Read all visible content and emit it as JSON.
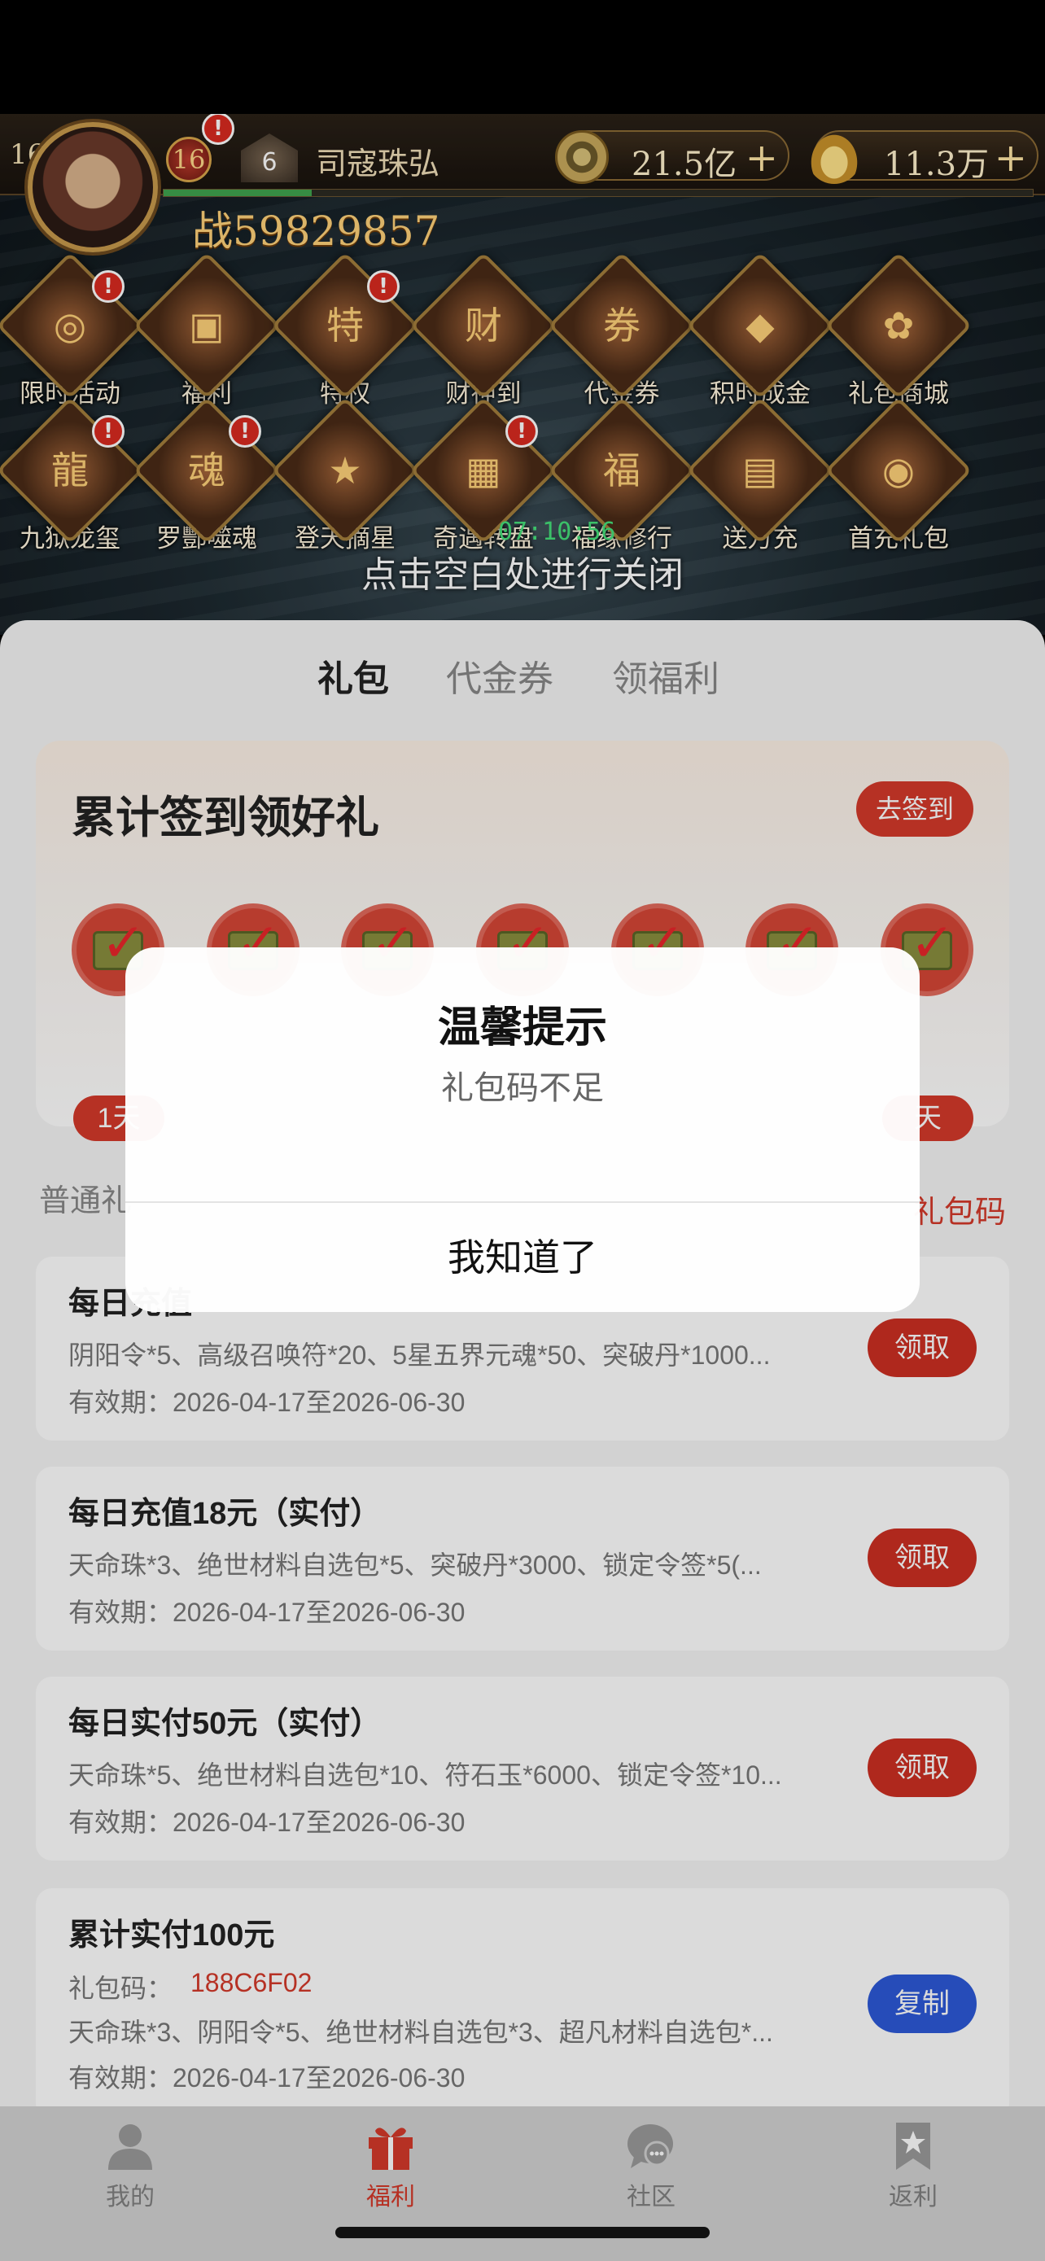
{
  "game": {
    "player_level": "166",
    "vip_level": "16",
    "rank_level": "6",
    "player_name": "司寇珠弘",
    "power": "战59829857",
    "exp_progress": 0.17,
    "currencies": [
      {
        "icon": "copper-coin-icon",
        "value": "21.5亿",
        "plus": "+"
      },
      {
        "icon": "gold-ingot-icon",
        "value": "11.3万",
        "plus": "+"
      }
    ],
    "red_dot": "!",
    "icons_row1": [
      {
        "label": "限时活动",
        "glyph": "◎",
        "badge": true
      },
      {
        "label": "福利",
        "glyph": "▣",
        "badge": false
      },
      {
        "label": "特权",
        "glyph": "特",
        "badge": true
      },
      {
        "label": "财神到",
        "glyph": "财",
        "badge": false
      },
      {
        "label": "代金券",
        "glyph": "券",
        "badge": false
      },
      {
        "label": "积时成金",
        "glyph": "◆",
        "badge": false
      },
      {
        "label": "礼包商城",
        "glyph": "✿",
        "badge": false
      }
    ],
    "icons_row2": [
      {
        "label": "九狱龙玺",
        "glyph": "龍",
        "badge": true
      },
      {
        "label": "罗酆噬魂",
        "glyph": "魂",
        "badge": true
      },
      {
        "label": "登天摘星",
        "glyph": "★",
        "badge": false
      },
      {
        "label": "奇遇转盘",
        "glyph": "▦",
        "badge": true
      },
      {
        "label": "福缘修行",
        "glyph": "福",
        "badge": false
      },
      {
        "label": "送万充",
        "glyph": "▤",
        "badge": false
      },
      {
        "label": "首充礼包",
        "glyph": "◉",
        "badge": false
      }
    ],
    "timer": "07:10:56",
    "close_hint": "点击空白处进行关闭"
  },
  "tabs": [
    {
      "label": "礼包",
      "active": true
    },
    {
      "label": "代金券",
      "active": false
    },
    {
      "label": "领福利",
      "active": false
    }
  ],
  "signin": {
    "title": "累计签到领好礼",
    "button": "去签到",
    "days_total": 7,
    "days_checked": 7,
    "first_day_pill": "1天",
    "last_day_pill": "天"
  },
  "section": {
    "label": "普通礼",
    "link": "礼包码"
  },
  "gifts": [
    {
      "title": "每日充值",
      "desc": "阴阳令*5、高级召唤符*20、5星五界元魂*50、突破丹*1000...",
      "date": "有效期：2026-04-17至2026-06-30",
      "button": "领取"
    },
    {
      "title": "每日充值18元（实付）",
      "desc": "天命珠*3、绝世材料自选包*5、突破丹*3000、锁定令签*5(...",
      "date": "有效期：2026-04-17至2026-06-30",
      "button": "领取"
    },
    {
      "title": "每日实付50元（实付）",
      "desc": "天命珠*5、绝世材料自选包*10、符石玉*6000、锁定令签*10...",
      "date": "有效期：2026-04-17至2026-06-30",
      "button": "领取"
    },
    {
      "title": "累计实付100元",
      "code_label": "礼包码：",
      "code": "188C6F02",
      "desc": "天命珠*3、阴阳令*5、绝世材料自选包*3、超凡材料自选包*...",
      "date": "有效期：2026-04-17至2026-06-30",
      "button": "复制"
    }
  ],
  "dialog": {
    "title": "温馨提示",
    "message": "礼包码不足",
    "button": "我知道了"
  },
  "nav": [
    {
      "label": "我的",
      "icon": "person-icon",
      "active": false
    },
    {
      "label": "福利",
      "icon": "gift-icon",
      "active": true
    },
    {
      "label": "社区",
      "icon": "chat-bubble-icon",
      "active": false
    },
    {
      "label": "返利",
      "icon": "bookmark-star-icon",
      "active": false
    }
  ],
  "colors": {
    "accent_red": "#d43a2b",
    "copy_blue": "#2d59d8",
    "timer_green": "#45e07a"
  }
}
